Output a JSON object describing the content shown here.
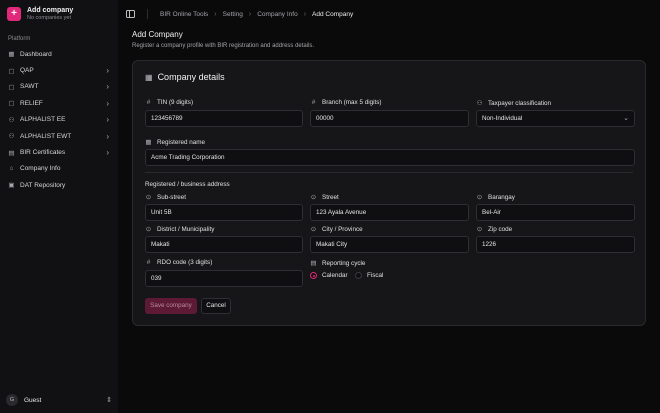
{
  "brand": {
    "title": "Add company",
    "subtitle": "No companies yet"
  },
  "sidebar": {
    "group_label": "Platform",
    "items": [
      {
        "label": "Dashboard",
        "icon": "grid-icon",
        "glyph": "▦",
        "has_children": false
      },
      {
        "label": "QAP",
        "icon": "file-icon",
        "glyph": "▢",
        "has_children": true
      },
      {
        "label": "SAWT",
        "icon": "file-icon",
        "glyph": "▢",
        "has_children": true
      },
      {
        "label": "RELIEF",
        "icon": "file-icon",
        "glyph": "▢",
        "has_children": true
      },
      {
        "label": "ALPHALIST EE",
        "icon": "users-icon",
        "glyph": "⚇",
        "has_children": true
      },
      {
        "label": "ALPHALIST EWT",
        "icon": "users-icon",
        "glyph": "⚇",
        "has_children": true
      },
      {
        "label": "BIR Certificates",
        "icon": "certificate-icon",
        "glyph": "▤",
        "has_children": true
      },
      {
        "label": "Company Info",
        "icon": "building-icon",
        "glyph": "⌂",
        "has_children": false
      },
      {
        "label": "DAT Repository",
        "icon": "database-icon",
        "glyph": "▣",
        "has_children": false
      }
    ],
    "user": {
      "initial": "G",
      "name": "Guest"
    }
  },
  "breadcrumb": {
    "items": [
      "BIR Online Tools",
      "Setting",
      "Company Info",
      "Add Company"
    ]
  },
  "header": {
    "title": "Add Company",
    "subtitle": "Register a company profile with BIR registration and address details."
  },
  "form": {
    "card_title": "Company details",
    "tin": {
      "label": "TIN (9 digits)",
      "value": "123456789"
    },
    "branch": {
      "label": "Branch (max 5 digits)",
      "value": "00000"
    },
    "taxpayer": {
      "label": "Taxpayer classification",
      "value": "Non-Individual"
    },
    "registered_name": {
      "label": "Registered name",
      "value": "Acme Trading Corporation"
    },
    "address_section": "Registered / business address",
    "sub_street": {
      "label": "Sub-street",
      "value": "Unit 5B"
    },
    "street": {
      "label": "Street",
      "value": "123 Ayala Avenue"
    },
    "barangay": {
      "label": "Barangay",
      "value": "Bel-Air"
    },
    "district": {
      "label": "District / Municipality",
      "value": "Makati"
    },
    "city": {
      "label": "City / Province",
      "value": "Makati City"
    },
    "zip": {
      "label": "Zip code",
      "value": "1226"
    },
    "rdo": {
      "label": "RDO code (3 digits)",
      "value": "039"
    },
    "reporting": {
      "label": "Reporting cycle",
      "options": [
        "Calendar",
        "Fiscal"
      ],
      "selected": "Calendar"
    },
    "save_label": "Save company",
    "cancel_label": "Cancel"
  },
  "colors": {
    "accent": "#e0297a",
    "background": "#0a0a0b",
    "card": "#161618",
    "sidebar": "#111113"
  }
}
